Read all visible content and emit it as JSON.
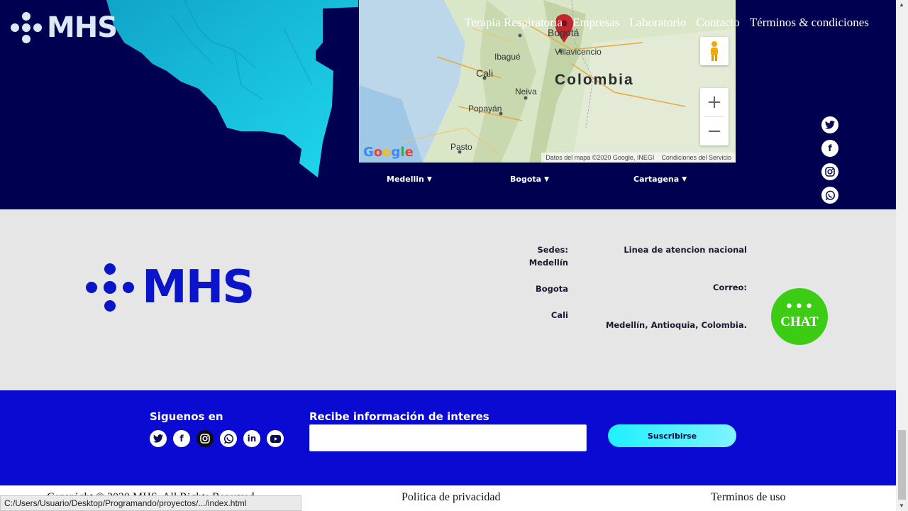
{
  "brand": {
    "name": "MHS"
  },
  "nav": {
    "items": [
      "Terapia Respiratoria",
      "Empresas",
      "Laboratorio",
      "Contacto",
      "Términos & condiciones"
    ]
  },
  "map": {
    "labels": {
      "colombia": "Colombia",
      "bogota": "Bogotá",
      "villavicencio": "Villavicencio",
      "ibague": "Ibagué",
      "cali": "Cali",
      "neiva": "Neiva",
      "popayan": "Popayán",
      "pasto": "Pasto"
    },
    "google": "Google",
    "attribution": "Datos del mapa ©2020 Google, INEGI",
    "terms": "Condiciones del Servicio",
    "zoom_in": "+",
    "zoom_out": "−"
  },
  "city_tabs": [
    "Medellin",
    "Bogota",
    "Cartagena"
  ],
  "social": [
    "twitter",
    "facebook",
    "instagram",
    "whatsapp",
    "linkedin",
    "youtube"
  ],
  "info": {
    "sedes_label": "Sedes:",
    "sede1": "Medellín",
    "sede2": "Bogota",
    "sede3": "Cali",
    "linea": "Linea de atencion nacional",
    "correo": "Correo:",
    "address": "Medellín, Antioquia, Colombia."
  },
  "chat": {
    "dots": "•••",
    "label": "CHAT"
  },
  "subscribe": {
    "follow_title": "Siguenos en",
    "info_title": "Recibe información de interes",
    "email_value": "",
    "button": "Suscribirse"
  },
  "footer": {
    "copyright": "Copyright © 2020 MHS. All Rights Reserved",
    "privacy": "Politica de privacidad",
    "terms": "Terminos de uso"
  },
  "status_bar": "C:/Users/Usuario/Desktop/Programando/proyectos/.../index.html",
  "colors": {
    "navy": "#000050",
    "brand_blue": "#0a14c8",
    "subscribe_blue": "#0a0ad2",
    "chat_green": "#3ccc14",
    "cyan": "#1ff0ff"
  }
}
